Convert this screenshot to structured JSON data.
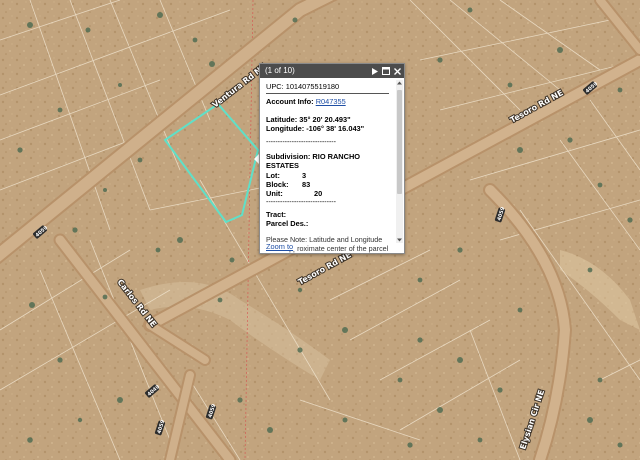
{
  "map": {
    "road_labels": [
      "Ventura Rd NE",
      "Tesoro Rd NE",
      "Tesoro Rd NE",
      "Carlos Rd NE",
      "Elysian Cir NE"
    ],
    "shield_labels": [
      "4059",
      "4049",
      "4059",
      "4059",
      "4059",
      "4059"
    ],
    "colors": {
      "parcel_outline": "#5fe0c8",
      "road": "#c7a47c",
      "ground": "#c2a47e",
      "county_line": "#d84a4a"
    }
  },
  "popup": {
    "title": "(1 of 10)",
    "upc": "UPC: 1014075519180",
    "account_label": "Account Info:",
    "account_link": "R047355",
    "latitude": "Latitude: 35° 20' 20.493\"",
    "longitude": "Longitude: -106° 38' 16.043\"",
    "separator": "------------------------------",
    "subdivision_label": "Subdivision:",
    "subdivision_value": "RIO RANCHO",
    "subdivision_value2": "ESTATES",
    "lot_label": "Lot:",
    "lot_value": "3",
    "block_label": "Block:",
    "block_value": "83",
    "unit_label": "Unit:",
    "unit_value": "20",
    "tract_label": "Tract:",
    "parcel_label": "Parcel Des.:",
    "note": "Please Note: Latitude and Longitude is the approximate center of the parcel shown",
    "zoom_link": "Zoom to"
  }
}
